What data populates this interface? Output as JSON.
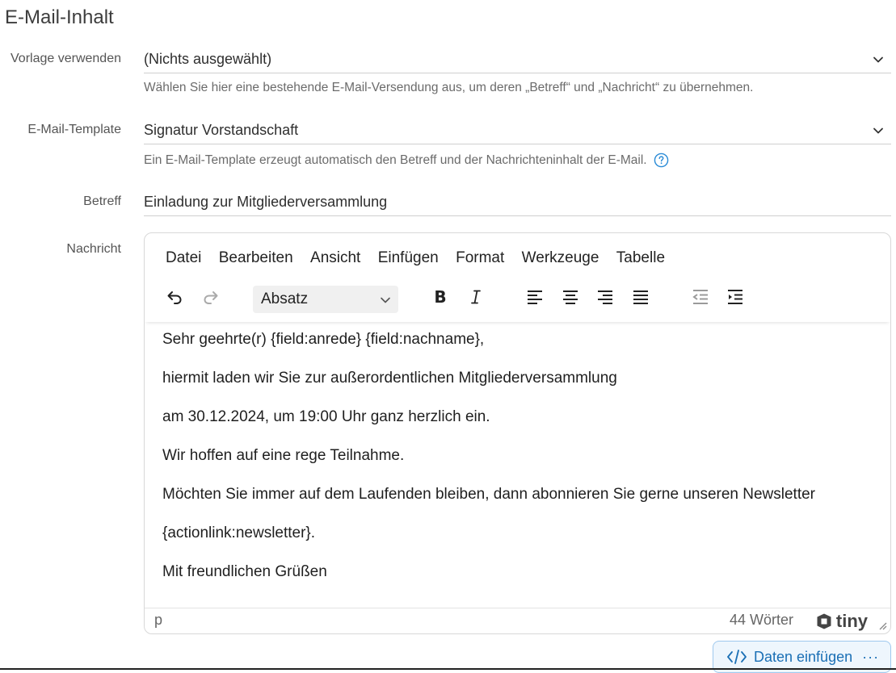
{
  "section_title": "E-Mail-Inhalt",
  "template_select": {
    "label": "Vorlage verwenden",
    "value": "(Nichts ausgewählt)",
    "help": "Wählen Sie hier eine bestehende E-Mail-Versendung aus, um deren „Betreff“ und „Nachricht“ zu übernehmen."
  },
  "email_template": {
    "label": "E-Mail-Template",
    "value": "Signatur Vorstandschaft",
    "help": "Ein E-Mail-Template erzeugt automatisch den Betreff und der Nachrichteninhalt der E-Mail."
  },
  "subject": {
    "label": "Betreff",
    "value": "Einladung zur Mitgliederversammlung"
  },
  "message": {
    "label": "Nachricht",
    "menubar": [
      "Datei",
      "Bearbeiten",
      "Ansicht",
      "Einfügen",
      "Format",
      "Werkzeuge",
      "Tabelle"
    ],
    "block_format": "Absatz",
    "toolbar_icons": [
      "undo-icon",
      "redo-icon",
      "bold-icon",
      "italic-icon",
      "align-left-icon",
      "align-center-icon",
      "align-right-icon",
      "align-justify-icon",
      "outdent-icon",
      "indent-icon"
    ],
    "paragraphs": [
      "Sehr geehrte(r) {field:anrede} {field:nachname},",
      "hiermit laden wir Sie zur außerordentlichen Mitgliederversammlung",
      "am 30.12.2024, um 19:00 Uhr ganz herzlich ein.",
      "Wir hoffen auf eine rege Teilnahme.",
      "Möchten Sie immer auf dem Laufenden bleiben, dann abonnieren Sie gerne unseren Newsletter",
      "{actionlink:newsletter}.",
      "Mit freundlichen Grüßen"
    ],
    "status_path": "p",
    "word_count": "44 Wörter",
    "brand": "tiny"
  },
  "insert_button": {
    "label": "Daten einfügen",
    "dots": "···"
  },
  "colors": {
    "accent": "#1a6fb5",
    "help_icon": "#2a8bd6"
  }
}
